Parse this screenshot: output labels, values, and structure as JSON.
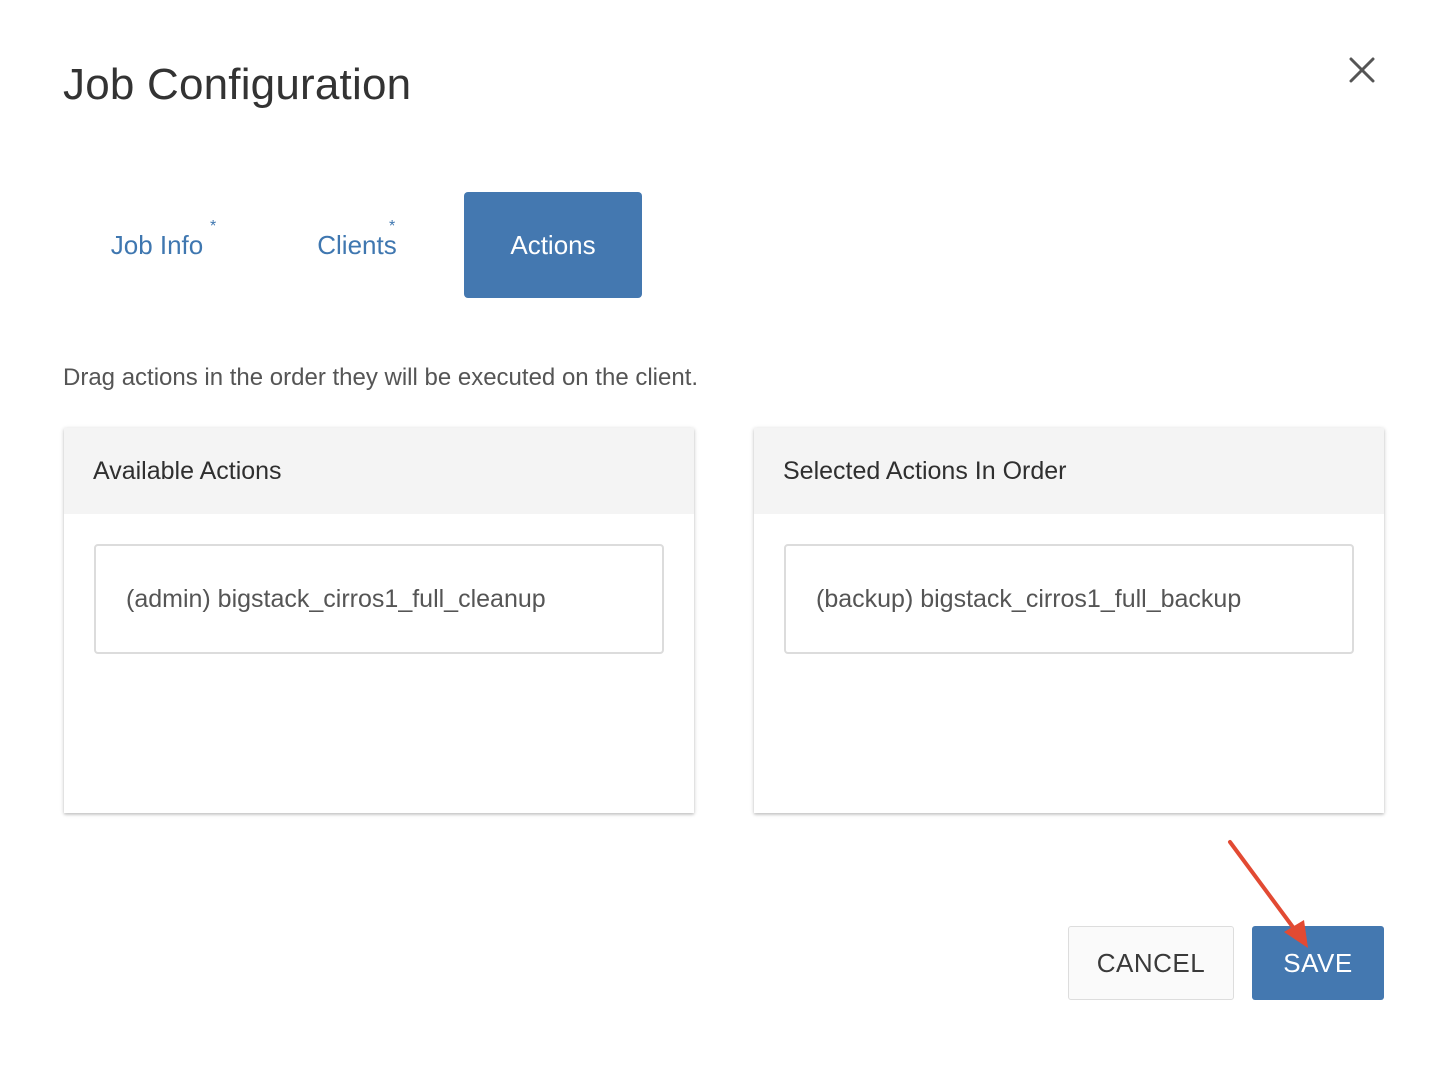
{
  "dialog": {
    "title": "Job Configuration",
    "close_icon": "close-icon"
  },
  "tabs": [
    {
      "label": "Job Info",
      "required_marker": "*",
      "active": false
    },
    {
      "label": "Clients",
      "required_marker": "*",
      "active": false
    },
    {
      "label": "Actions",
      "active": true
    }
  ],
  "instructions": "Drag actions in the order they will be executed on the client.",
  "available_panel": {
    "title": "Available Actions",
    "items": [
      "(admin) bigstack_cirros1_full_cleanup"
    ]
  },
  "selected_panel": {
    "title": "Selected Actions In Order",
    "items": [
      "(backup) bigstack_cirros1_full_backup"
    ]
  },
  "footer": {
    "cancel_label": "CANCEL",
    "save_label": "SAVE"
  },
  "colors": {
    "accent": "#4478b0",
    "tab_text": "#3f77b0",
    "annotation_arrow": "#e24a33"
  }
}
